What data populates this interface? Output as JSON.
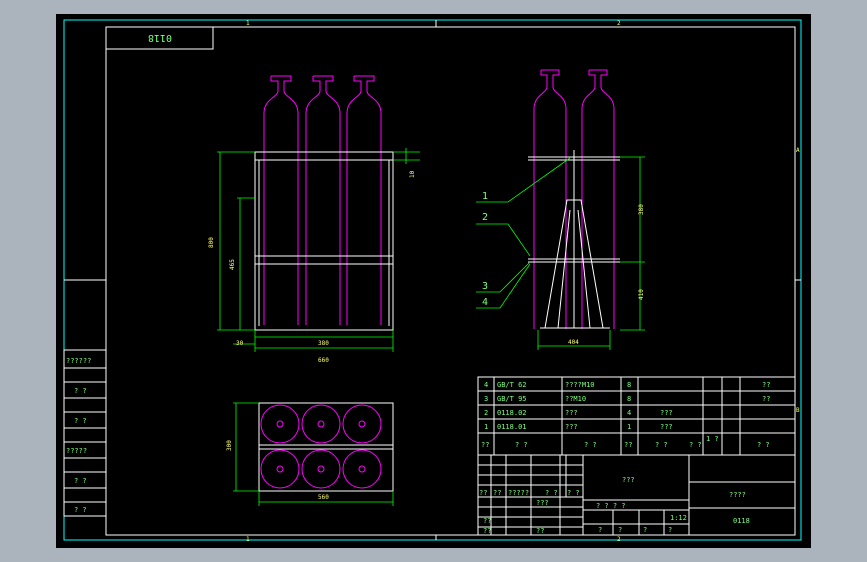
{
  "drawing_code": "0118",
  "grid_labels": {
    "top_left": "1",
    "top_mid": "2",
    "bottom_left": "1",
    "bottom_mid": "2",
    "right_a": "A",
    "right_b": "B"
  },
  "dimensions": {
    "front_top_gap": "10",
    "front_height": "800",
    "front_mid_height": "465",
    "front_bottom_offset": "30",
    "front_inner_width": "380",
    "front_outer_width": "660",
    "side_upper": "380",
    "side_lower": "410",
    "side_base": "404",
    "plan_depth": "300",
    "plan_width": "560"
  },
  "callouts": [
    "1",
    "2",
    "3",
    "4"
  ],
  "left_stamps": [
    "??????",
    "? ?",
    "? ?",
    "?????",
    "? ?",
    "? ?"
  ],
  "bom_rows": [
    {
      "no": "4",
      "code": "GB/T 62",
      "name": "????M10",
      "qty": "8",
      "material": "",
      "note": "??"
    },
    {
      "no": "3",
      "code": "GB/T 95",
      "name": "??M10",
      "qty": "8",
      "material": "",
      "note": "??"
    },
    {
      "no": "2",
      "code": "0118.02",
      "name": "???",
      "qty": "4",
      "material": "???",
      "note": ""
    },
    {
      "no": "1",
      "code": "0118.01",
      "name": "???",
      "qty": "1",
      "material": "???",
      "note": ""
    }
  ],
  "bom_header": [
    "??",
    "? ?",
    "? ?",
    "??",
    "? ?",
    "? ?",
    "1 ?",
    "? ?"
  ],
  "title_block": {
    "part_name": "???",
    "company": "????",
    "drawing_no": "0118",
    "scale": "1:12",
    "signature_row": [
      "??",
      "??",
      "?????",
      "? ?",
      "? ?"
    ],
    "approval_cells": [
      "??",
      "??",
      "???",
      "??"
    ],
    "stage_label": "? ? ? ?",
    "sheet_marks": [
      "?",
      "?",
      "?",
      "?"
    ]
  },
  "colors": {
    "background": "#000000",
    "frame": "#00ffff",
    "bottle": "#ff00ff",
    "structure": "#ffffff",
    "dimension": "#00ff00",
    "outer_panel": "#abb3bd"
  }
}
